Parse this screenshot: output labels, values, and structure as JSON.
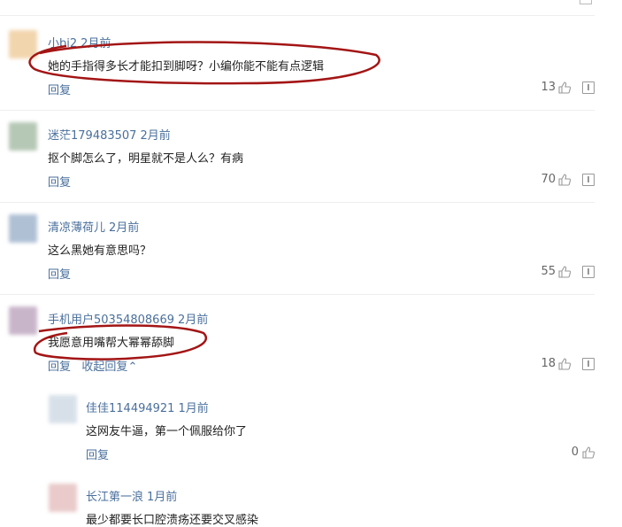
{
  "comments": [
    {
      "user": "小bi2",
      "time": "2月前",
      "text": "她的手指得多长才能扣到脚呀？小编你能不能有点逻辑",
      "reply": "回复",
      "likes": "13",
      "avatar_color": "#e6b36b"
    },
    {
      "user": "迷茫179483507",
      "time": "2月前",
      "text": "抠个脚怎么了，明星就不是人么？有病",
      "reply": "回复",
      "likes": "70",
      "avatar_color": "#7a9a7a"
    },
    {
      "user": "清凉薄荷儿",
      "time": "2月前",
      "text": "这么黑她有意思吗？",
      "reply": "回复",
      "likes": "55",
      "avatar_color": "#6f8db3"
    },
    {
      "user": "手机用户50354808669",
      "time": "2月前",
      "text": "我愿意用嘴帮大幂幂舔脚",
      "reply": "回复",
      "collapse": "收起回复",
      "likes": "18",
      "avatar_color": "#9d7aa0"
    }
  ],
  "replies": [
    {
      "user": "佳佳114494921",
      "time": "1月前",
      "text": "这网友牛逼，第一个佩服给你了",
      "reply": "回复",
      "likes": "0",
      "avatar_color": "#b8c8d8"
    },
    {
      "user": "长江第一浪",
      "time": "1月前",
      "text": "最少都要长口腔溃疡还要交叉感染",
      "avatar_color": "#d9a0a0"
    }
  ],
  "icons": {
    "like": "thumbs-up-icon",
    "report": "report-icon",
    "collapse": "chevron-up-icon"
  }
}
